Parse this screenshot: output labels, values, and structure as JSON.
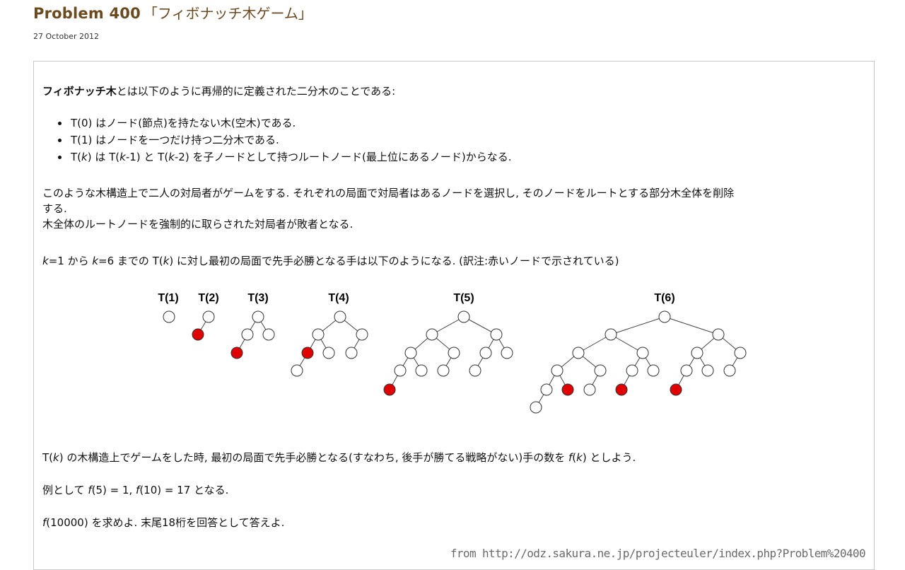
{
  "header": {
    "title": "Problem 400",
    "subtitle": "「フィボナッチ木ゲーム」",
    "date": "27 October 2012"
  },
  "content": {
    "intro_term": "フィボナッチ木",
    "intro_rest": "とは以下のように再帰的に定義された二分木のことである:",
    "rules": [
      {
        "pre": "T(0)",
        "text": " はノード(節点)を持たない木(空木)である."
      },
      {
        "pre": "T(1)",
        "text": " はノードを一つだけ持つ二分木である."
      },
      {
        "pre": "T(",
        "k": "k",
        "post": ")",
        "mid": " は ",
        "a": "T(",
        "ak": "k",
        "a2": "-1)",
        "mid2": " と ",
        "b": "T(",
        "bk": "k",
        "b2": "-2)",
        "text": " を子ノードとして持つルートノード(最上位にあるノード)からなる."
      }
    ],
    "game_line1": "このような木構造上で二人の対局者がゲームをする. それぞれの局面で対局者はあるノードを選択し, そのノードをルートとする部分木全体を削除",
    "game_line2": "する.",
    "game_line3": "木全体のルートノードを強制的に取らされた対局者が敗者となる.",
    "example_k1": "k",
    "example_v1": "=1 から ",
    "example_k2": "k",
    "example_v2": "=6 までの ",
    "example_t": "T(",
    "example_tk": "k",
    "example_t2": ")",
    "example_rest": " に対し最初の局面で先手必勝となる手は以下のようになる. (訳注:赤いノードで示されている)",
    "def_pre": "T(",
    "def_k": "k",
    "def_mid": ") の木構造上でゲームをした時, 最初の局面で先手必勝となる(すなわち, 後手が勝てる戦略がない)手の数を ",
    "def_f": "f",
    "def_fk": "(",
    "def_k2": "k",
    "def_close": ")",
    "def_end": " としよう.",
    "ex_pre": "例として ",
    "ex_f1": "f",
    "ex_v1": "(5) = 1, ",
    "ex_f2": "f",
    "ex_v2": "(10) = 17",
    "ex_end": " となる.",
    "task_f": "f",
    "task_v": "(10000)",
    "task_end": " を求めよ. 末尾18桁を回答として答えよ."
  },
  "figure": {
    "labels": [
      "T(1)",
      "T(2)",
      "T(3)",
      "T(4)",
      "T(5)",
      "T(6)"
    ],
    "win_color": "#e00000",
    "node_color": "#ffffff"
  },
  "footer": {
    "source": "from http://odz.sakura.ne.jp/projecteuler/index.php?Problem%20400"
  }
}
